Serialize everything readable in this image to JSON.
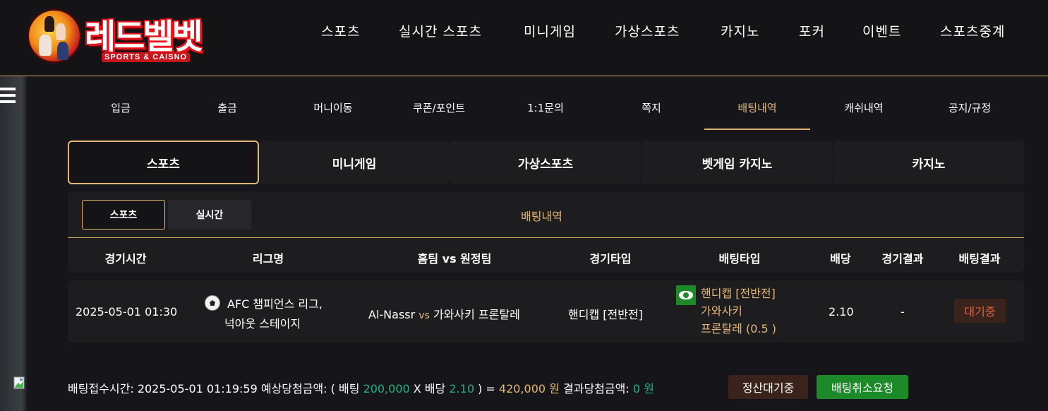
{
  "header": {
    "logo_text": "레드벨벳",
    "logo_sub": "SPORTS & CAISNO",
    "nav": [
      "스포츠",
      "실시간 스포츠",
      "미니게임",
      "가상스포츠",
      "카지노",
      "포커",
      "이벤트",
      "스포츠중계"
    ]
  },
  "sub_nav": {
    "items": [
      "입금",
      "출금",
      "머니이동",
      "쿠폰/포인트",
      "1:1문의",
      "쪽지",
      "배팅내역",
      "캐쉬내역",
      "공지/규정"
    ],
    "active": "배팅내역"
  },
  "category_tabs": {
    "items": [
      "스포츠",
      "미니게임",
      "가상스포츠",
      "벳게임 카지노",
      "카지노"
    ],
    "active": "스포츠"
  },
  "panel": {
    "subtabs": [
      "스포츠",
      "실시간"
    ],
    "title": "배팅내역",
    "columns": [
      "경기시간",
      "리그명",
      "홈팀 vs 원정팀",
      "경기타입",
      "배팅타입",
      "배당",
      "경기결과",
      "배팅결과"
    ]
  },
  "rows": [
    {
      "time": "2025-05-01 01:30",
      "league_line1": "AFC 챔피언스 리그,",
      "league_line2": "넉아웃 스테이지",
      "home": "Al-Nassr",
      "vs": "vs",
      "away": "가와사키 프론탈레",
      "game_type": "핸디캡 [전반전]",
      "bet_type_line1": "핸디캡 [전반전]",
      "bet_type_line2": "가와사키",
      "bet_type_line3": "프론탈레 (0.5 )",
      "odds": "2.10",
      "game_result": "-",
      "bet_result": "대기중"
    }
  ],
  "footer": {
    "receipt_label": "배팅접수시간:",
    "receipt_time": "2025-05-01 01:19:59",
    "expected_label": "예상당첨금액: ( 배팅",
    "bet_amount": "200,000",
    "x_label": "X 배당",
    "odds": "2.10",
    "eq_label": ") =",
    "expected_amount": "420,000",
    "won": "원",
    "result_label": "결과당첨금액:",
    "result_amount": "0",
    "result_won": "원",
    "pending_button": "정산대기중",
    "cancel_button": "배팅취소요청"
  },
  "colors": {
    "accent": "#e3b775",
    "green": "#20b07f",
    "status": "#e0653f"
  }
}
